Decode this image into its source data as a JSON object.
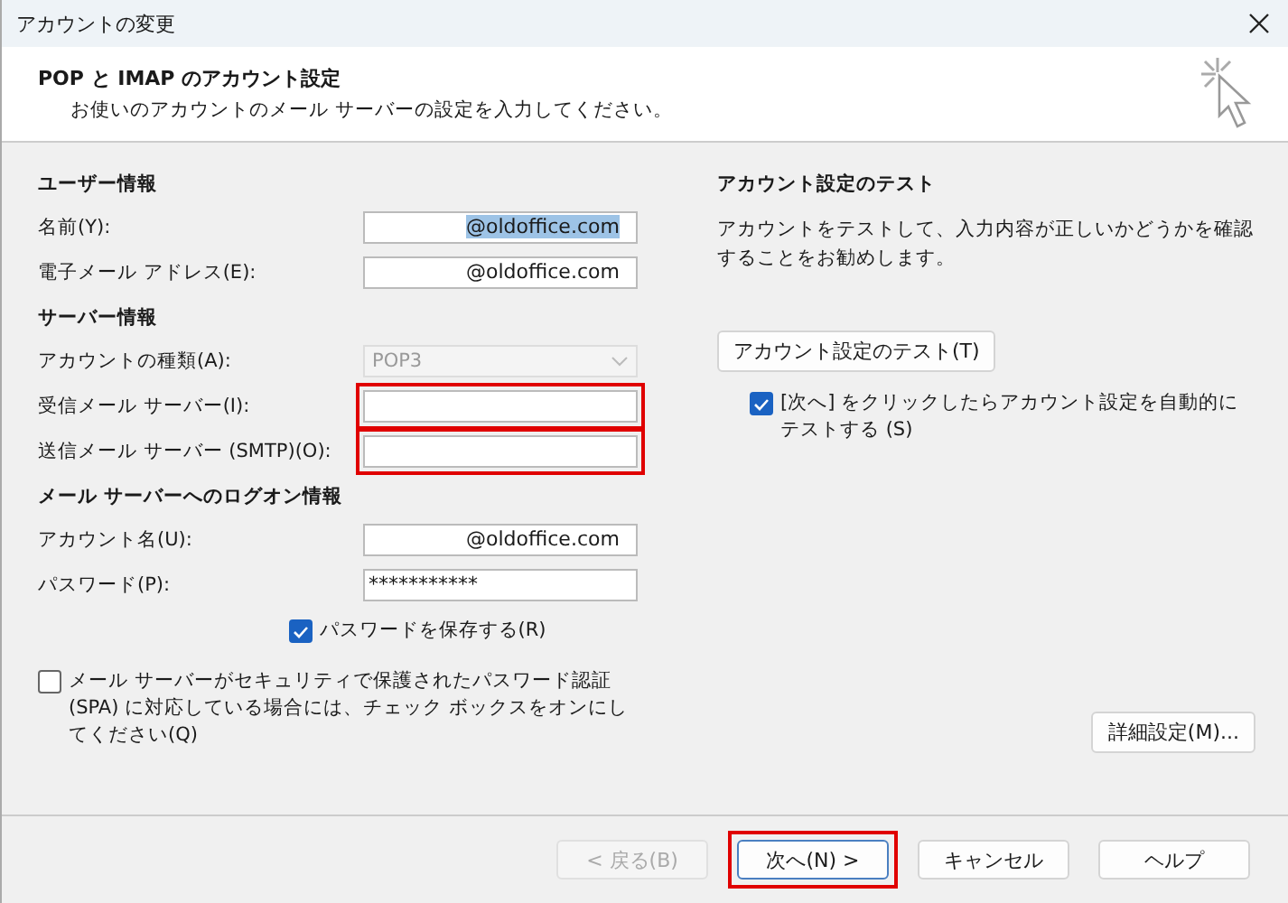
{
  "window": {
    "title": "アカウントの変更"
  },
  "header": {
    "title": "POP と IMAP のアカウント設定",
    "subtitle": "お使いのアカウントのメール サーバーの設定を入力してください。"
  },
  "sections": [
    {
      "heading": "ユーザー情報",
      "fields": [
        {
          "kind": "text",
          "label": "名前(Y):",
          "value": "@oldoffice.com",
          "text_selected": true,
          "highlighted": false,
          "disabled": false
        },
        {
          "kind": "text",
          "label": "電子メール アドレス(E):",
          "value": "@oldoffice.com",
          "text_selected": false,
          "highlighted": false,
          "disabled": false
        }
      ]
    },
    {
      "heading": "サーバー情報",
      "fields": [
        {
          "kind": "dropdown",
          "label": "アカウントの種類(A):",
          "value": "POP3",
          "highlighted": false,
          "disabled": true
        },
        {
          "kind": "text",
          "label": "受信メール サーバー(I):",
          "highlighted": true,
          "disabled": false
        },
        {
          "kind": "text",
          "label": "送信メール サーバー (SMTP)(O):",
          "highlighted": true,
          "disabled": false
        }
      ]
    },
    {
      "heading": "メール サーバーへのログオン情報",
      "fields": [
        {
          "kind": "text",
          "label": "アカウント名(U):",
          "value": "@oldoffice.com",
          "text_selected": false,
          "highlighted": false,
          "disabled": false
        },
        {
          "kind": "password",
          "label": "パスワード(P):",
          "value": "***********",
          "highlighted": false,
          "disabled": false
        }
      ]
    }
  ],
  "remember_password": {
    "label": "パスワードを保存する(R)",
    "checked": true
  },
  "spa": {
    "label": "メール サーバーがセキュリティで保護されたパスワード認証 (SPA) に対応している場合には、チェック ボックスをオンにしてください(Q)",
    "checked": false
  },
  "test": {
    "heading": "アカウント設定のテスト",
    "description": "アカウントをテストして、入力内容が正しいかどうかを確認することをお勧めします。",
    "button": "アカウント設定のテスト(T)",
    "auto_test": {
      "label": "[次へ] をクリックしたらアカウント設定を自動的にテストする (S)",
      "checked": true
    }
  },
  "more_settings": "詳細設定(M)...",
  "buttons": [
    {
      "label": "< 戻る(B)",
      "disabled": true,
      "highlighted": false,
      "default": false
    },
    {
      "label": "次へ(N) >",
      "disabled": false,
      "highlighted": true,
      "default": true
    },
    {
      "label": "キャンセル",
      "disabled": false,
      "highlighted": false,
      "default": false
    },
    {
      "label": "ヘルプ",
      "disabled": false,
      "highlighted": false,
      "default": false
    }
  ]
}
